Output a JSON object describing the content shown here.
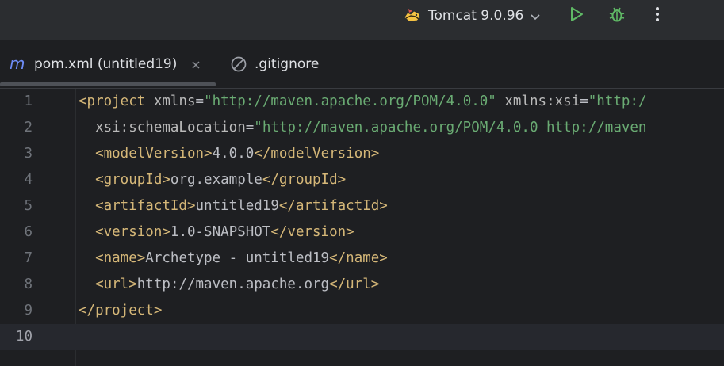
{
  "toolbar": {
    "run_config": {
      "label": "Tomcat 9.0.96",
      "icon": "tomcat-icon"
    },
    "run_icon": "play-icon",
    "debug_icon": "bug-icon",
    "more_icon": "more-vertical-icon",
    "colors": {
      "run": "#5fb865",
      "debug": "#5fb865"
    }
  },
  "tabs": [
    {
      "label": "pom.xml (untitled19)",
      "icon": "maven-m-icon",
      "active": true,
      "close_icon": "close-icon"
    },
    {
      "label": ".gitignore",
      "icon": "ignored-file-icon",
      "active": false
    }
  ],
  "editor": {
    "current_line": "10",
    "lines": [
      {
        "num": "1",
        "segments": [
          {
            "t": "tag",
            "v": "<project"
          },
          {
            "t": "txt",
            "v": " "
          },
          {
            "t": "attr",
            "v": "xmlns"
          },
          {
            "t": "txt",
            "v": "="
          },
          {
            "t": "val",
            "v": "\"http://maven.apache.org/POM/4.0.0\""
          },
          {
            "t": "txt",
            "v": " "
          },
          {
            "t": "attr",
            "v": "xmlns:xsi"
          },
          {
            "t": "txt",
            "v": "="
          },
          {
            "t": "val",
            "v": "\"http:/"
          }
        ]
      },
      {
        "num": "2",
        "segments": [
          {
            "t": "txt",
            "v": "  "
          },
          {
            "t": "attr",
            "v": "xsi:schemaLocation"
          },
          {
            "t": "txt",
            "v": "="
          },
          {
            "t": "val",
            "v": "\"http://maven.apache.org/POM/4.0.0 http://maven"
          }
        ]
      },
      {
        "num": "3",
        "segments": [
          {
            "t": "txt",
            "v": "  "
          },
          {
            "t": "tag",
            "v": "<modelVersion>"
          },
          {
            "t": "txt",
            "v": "4.0.0"
          },
          {
            "t": "tag",
            "v": "</modelVersion>"
          }
        ]
      },
      {
        "num": "4",
        "segments": [
          {
            "t": "txt",
            "v": "  "
          },
          {
            "t": "tag",
            "v": "<groupId>"
          },
          {
            "t": "txt",
            "v": "org.example"
          },
          {
            "t": "tag",
            "v": "</groupId>"
          }
        ]
      },
      {
        "num": "5",
        "segments": [
          {
            "t": "txt",
            "v": "  "
          },
          {
            "t": "tag",
            "v": "<artifactId>"
          },
          {
            "t": "txt",
            "v": "untitled19"
          },
          {
            "t": "tag",
            "v": "</artifactId>"
          }
        ]
      },
      {
        "num": "6",
        "segments": [
          {
            "t": "txt",
            "v": "  "
          },
          {
            "t": "tag",
            "v": "<version>"
          },
          {
            "t": "txt",
            "v": "1.0-SNAPSHOT"
          },
          {
            "t": "tag",
            "v": "</version>"
          }
        ]
      },
      {
        "num": "7",
        "segments": [
          {
            "t": "txt",
            "v": "  "
          },
          {
            "t": "tag",
            "v": "<name>"
          },
          {
            "t": "txt",
            "v": "Archetype - untitled19"
          },
          {
            "t": "tag",
            "v": "</name>"
          }
        ]
      },
      {
        "num": "8",
        "segments": [
          {
            "t": "txt",
            "v": "  "
          },
          {
            "t": "tag",
            "v": "<url>"
          },
          {
            "t": "txt",
            "v": "http://maven.apache.org"
          },
          {
            "t": "tag",
            "v": "</url>"
          }
        ]
      },
      {
        "num": "9",
        "segments": [
          {
            "t": "tag",
            "v": "</project>"
          }
        ]
      },
      {
        "num": "10",
        "segments": []
      }
    ]
  }
}
